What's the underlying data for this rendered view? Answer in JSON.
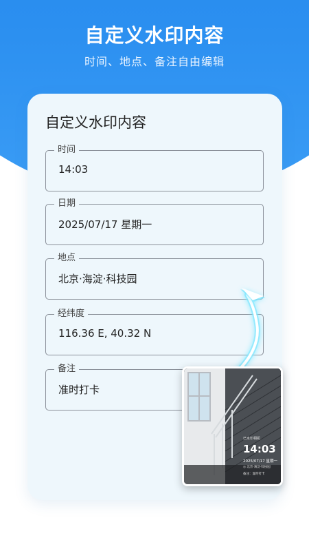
{
  "hero": {
    "title": "自定义水印内容",
    "subtitle": "时间、地点、备注自由编辑"
  },
  "card": {
    "title": "自定义水印内容",
    "fields": [
      {
        "label": "时间",
        "value": "14:03"
      },
      {
        "label": "日期",
        "value": "2025/07/17 星期一"
      },
      {
        "label": "地点",
        "value": "北京·海淀·科技园"
      },
      {
        "label": "经纬度",
        "value": "116.36 E, 40.32 N"
      },
      {
        "label": "备注",
        "value": "准时打卡"
      }
    ]
  },
  "preview": {
    "watermark": {
      "tag": "已水印相机",
      "time": "14:03",
      "date": "2025/07/17 星期一",
      "location": "◎ 北京·海淀·科技园",
      "note": "备注：准时打卡"
    }
  },
  "colors": {
    "brand_blue": "#2b8ff0",
    "card_bg": "#eef7fc",
    "arrow_glow": "#7fe7ff"
  }
}
